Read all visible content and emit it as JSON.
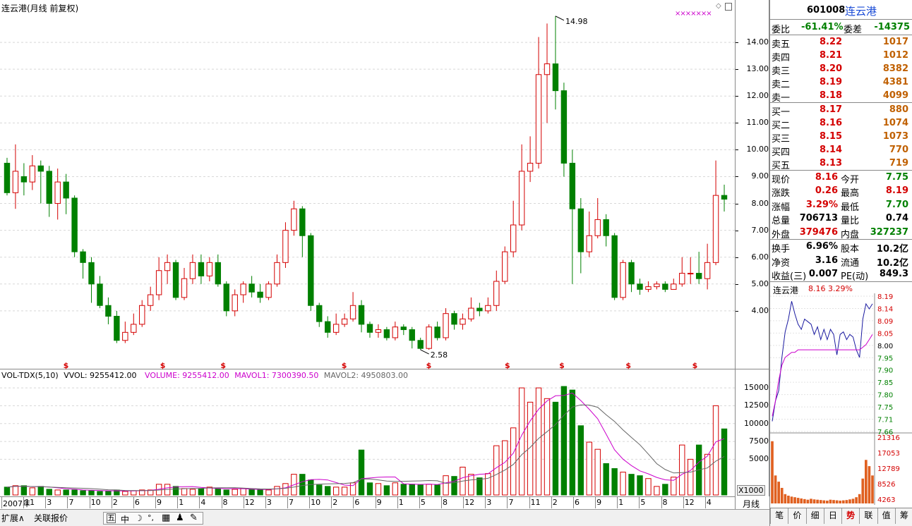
{
  "chart_header": "连云港(月线 前复权)",
  "price_labels": [
    "14.00",
    "13.00",
    "12.00",
    "11.00",
    "10.00",
    "9.00",
    "8.00",
    "7.00",
    "6.00",
    "5.00",
    "4.00"
  ],
  "price_values": [
    14,
    13,
    12,
    11,
    10,
    9,
    8,
    7,
    6,
    5,
    4
  ],
  "max_label": "14.98",
  "min_label": "2.58",
  "top_marker": "×××××××",
  "dollar_marks": [
    "$",
    "$",
    "$",
    "$",
    "$",
    "$",
    "$",
    "$",
    "$"
  ],
  "vol_header": {
    "title": "VOL-TDX(5,10)",
    "vvol": "VVOL: 9255412.00",
    "volume": "VOLUME: 9255412.00",
    "mavol1": "MAVOL1: 7300390.50",
    "mavol2": "MAVOL2: 4950803.00"
  },
  "vol_labels": [
    "15000",
    "12500",
    "10000",
    "7500",
    "5000"
  ],
  "vol_multiplier": "X1000",
  "time_labels": [
    "2007年",
    "11",
    "3",
    "7",
    "10",
    "2",
    "6",
    "9",
    "1",
    "4",
    "8",
    "12",
    "3",
    "7",
    "10",
    "2",
    "6",
    "9",
    "1",
    "5",
    "8",
    "12",
    "3",
    "7",
    "11",
    "2",
    "6",
    "9",
    "1",
    "5",
    "8",
    "12",
    "4"
  ],
  "period_label": "月线",
  "bottom_tabs": [
    "扩展∧",
    "关联报价"
  ],
  "toolbar_icons": [
    "五",
    "中",
    "☽",
    "°,",
    "▦",
    "♟",
    "✎"
  ],
  "quote": {
    "code": "601008",
    "name": "连云港",
    "weibi_label": "委比",
    "weibi": "-61.41%",
    "weicha_label": "委差",
    "weicha": "-14375",
    "sell": [
      {
        "label": "卖五",
        "price": "8.22",
        "vol": "1017"
      },
      {
        "label": "卖四",
        "price": "8.21",
        "vol": "1012"
      },
      {
        "label": "卖三",
        "price": "8.20",
        "vol": "8382"
      },
      {
        "label": "卖二",
        "price": "8.19",
        "vol": "4381"
      },
      {
        "label": "卖一",
        "price": "8.18",
        "vol": "4099"
      }
    ],
    "buy": [
      {
        "label": "买一",
        "price": "8.17",
        "vol": "880"
      },
      {
        "label": "买二",
        "price": "8.16",
        "vol": "1074"
      },
      {
        "label": "买三",
        "price": "8.15",
        "vol": "1073"
      },
      {
        "label": "买四",
        "price": "8.14",
        "vol": "770"
      },
      {
        "label": "买五",
        "price": "8.13",
        "vol": "719"
      }
    ],
    "stats": [
      {
        "l1": "现价",
        "v1": "8.16",
        "l2": "今开",
        "v2": "7.75",
        "c1": "red",
        "c2": "green"
      },
      {
        "l1": "涨跌",
        "v1": "0.26",
        "l2": "最高",
        "v2": "8.19",
        "c1": "red",
        "c2": "red"
      },
      {
        "l1": "涨幅",
        "v1": "3.29%",
        "l2": "最低",
        "v2": "7.70",
        "c1": "red",
        "c2": "green"
      },
      {
        "l1": "总量",
        "v1": "706713",
        "l2": "量比",
        "v2": "0.74",
        "c1": "black",
        "c2": "black"
      },
      {
        "l1": "外盘",
        "v1": "379476",
        "l2": "内盘",
        "v2": "327237",
        "c1": "red",
        "c2": "green"
      }
    ],
    "stats2": [
      {
        "l1": "换手",
        "v1": "6.96%",
        "l2": "股本",
        "v2": "10.2亿"
      },
      {
        "l1": "净资",
        "v1": "3.16",
        "l2": "流通",
        "v2": "10.2亿"
      },
      {
        "l1": "收益(三)",
        "v1": "0.007",
        "l2": "PE(动)",
        "v2": "849.3"
      }
    ]
  },
  "mini": {
    "name": "连云港",
    "price": "8.16",
    "pct": "3.29%",
    "price_labels": [
      "8.19",
      "8.14",
      "8.09",
      "8.05",
      "8.00",
      "7.95",
      "7.90",
      "7.85",
      "7.80",
      "7.75",
      "7.71",
      "7.66"
    ],
    "vol_labels": [
      "21316",
      "17053",
      "12789",
      "8526",
      "4263"
    ]
  },
  "right_tabs": [
    "笔",
    "价",
    "细",
    "日",
    "势",
    "联",
    "值",
    "筹"
  ],
  "colors": {
    "up": "#d40000",
    "down": "#008000",
    "ma1": "#cc00cc",
    "ma2": "#666666",
    "bg": "#ffffff"
  },
  "chart_data": {
    "type": "candlestick",
    "candles": [
      [
        9.5,
        8.4,
        9.7,
        8.3
      ],
      [
        8.4,
        9.2,
        10.2,
        7.8
      ],
      [
        9.0,
        8.8,
        9.5,
        8.3
      ],
      [
        8.8,
        9.4,
        9.8,
        8.5
      ],
      [
        9.4,
        9.2,
        9.6,
        8.0
      ],
      [
        9.2,
        8.0,
        9.4,
        7.5
      ],
      [
        8.0,
        8.8,
        9.3,
        7.4
      ],
      [
        8.8,
        8.2,
        9.1,
        7.6
      ],
      [
        8.2,
        6.2,
        8.3,
        6.0
      ],
      [
        6.2,
        5.8,
        6.3,
        5.2
      ],
      [
        5.8,
        5.0,
        6.0,
        4.3
      ],
      [
        5.0,
        4.2,
        5.3,
        4.1
      ],
      [
        4.2,
        3.8,
        4.5,
        3.5
      ],
      [
        3.8,
        2.9,
        4.0,
        2.8
      ],
      [
        2.9,
        3.2,
        3.6,
        2.8
      ],
      [
        3.2,
        3.5,
        3.9,
        3.1
      ],
      [
        3.5,
        4.2,
        4.4,
        3.4
      ],
      [
        4.2,
        4.6,
        4.9,
        4.0
      ],
      [
        4.6,
        5.5,
        6.0,
        4.4
      ],
      [
        5.5,
        5.8,
        6.1,
        5.0
      ],
      [
        5.8,
        4.5,
        5.9,
        4.4
      ],
      [
        4.5,
        5.2,
        5.6,
        4.4
      ],
      [
        5.2,
        5.8,
        6.1,
        5.0
      ],
      [
        5.8,
        5.3,
        6.1,
        5.0
      ],
      [
        5.3,
        5.8,
        6.0,
        5.1
      ],
      [
        5.8,
        5.0,
        6.1,
        4.9
      ],
      [
        5.0,
        4.0,
        5.1,
        3.8
      ],
      [
        4.0,
        4.6,
        4.8,
        3.8
      ],
      [
        4.6,
        5.0,
        5.1,
        4.3
      ],
      [
        5.0,
        4.7,
        5.3,
        4.5
      ],
      [
        4.7,
        4.5,
        5.0,
        4.3
      ],
      [
        4.5,
        5.0,
        5.1,
        4.4
      ],
      [
        5.0,
        5.8,
        6.1,
        4.9
      ],
      [
        5.8,
        7.0,
        7.3,
        5.6
      ],
      [
        7.0,
        7.8,
        8.1,
        6.8
      ],
      [
        7.8,
        6.8,
        7.9,
        6.0
      ],
      [
        6.8,
        4.2,
        6.9,
        4.0
      ],
      [
        4.2,
        3.6,
        4.3,
        3.4
      ],
      [
        3.6,
        3.2,
        3.8,
        3.0
      ],
      [
        3.2,
        3.5,
        3.9,
        3.1
      ],
      [
        3.5,
        3.7,
        3.9,
        3.4
      ],
      [
        3.7,
        4.2,
        4.7,
        3.6
      ],
      [
        4.2,
        3.5,
        4.4,
        3.2
      ],
      [
        3.5,
        3.2,
        3.6,
        3.0
      ],
      [
        3.2,
        3.3,
        3.5,
        3.0
      ],
      [
        3.3,
        3.0,
        3.4,
        2.9
      ],
      [
        3.0,
        3.4,
        3.6,
        2.9
      ],
      [
        3.4,
        3.3,
        3.5,
        3.1
      ],
      [
        3.3,
        2.9,
        3.4,
        2.6
      ],
      [
        2.9,
        2.6,
        3.0,
        2.55
      ],
      [
        2.6,
        3.4,
        3.5,
        2.55
      ],
      [
        3.4,
        3.0,
        3.6,
        2.9
      ],
      [
        3.0,
        3.9,
        4.1,
        2.9
      ],
      [
        3.9,
        3.5,
        4.0,
        3.3
      ],
      [
        3.5,
        3.7,
        3.9,
        3.3
      ],
      [
        3.7,
        4.1,
        4.5,
        3.6
      ],
      [
        4.1,
        4.0,
        4.3,
        3.8
      ],
      [
        4.0,
        4.2,
        4.5,
        3.9
      ],
      [
        4.2,
        5.1,
        5.5,
        4.0
      ],
      [
        5.1,
        6.2,
        6.4,
        5.0
      ],
      [
        6.2,
        7.2,
        8.1,
        6.0
      ],
      [
        7.2,
        9.2,
        10.2,
        7.0
      ],
      [
        9.2,
        9.5,
        10.5,
        8.8
      ],
      [
        9.5,
        12.8,
        14.2,
        9.3
      ],
      [
        12.8,
        13.2,
        14.7,
        11.0
      ],
      [
        13.2,
        12.2,
        14.98,
        11.5
      ],
      [
        12.2,
        9.5,
        12.5,
        9.0
      ],
      [
        9.5,
        7.8,
        10.0,
        5.0
      ],
      [
        7.8,
        6.2,
        8.2,
        5.4
      ],
      [
        6.2,
        6.8,
        7.7,
        6.0
      ],
      [
        6.8,
        7.4,
        8.2,
        6.7
      ],
      [
        7.4,
        6.8,
        7.6,
        6.4
      ],
      [
        6.8,
        4.5,
        6.9,
        4.4
      ],
      [
        4.5,
        5.8,
        5.9,
        4.4
      ],
      [
        5.8,
        5.0,
        5.9,
        4.7
      ],
      [
        5.0,
        4.8,
        5.2,
        4.6
      ],
      [
        4.8,
        4.9,
        5.1,
        4.7
      ],
      [
        4.9,
        5.0,
        5.1,
        4.8
      ],
      [
        5.0,
        4.8,
        5.1,
        4.7
      ],
      [
        4.8,
        5.0,
        5.2,
        4.8
      ],
      [
        5.0,
        5.4,
        6.0,
        4.9
      ],
      [
        5.4,
        5.4,
        6.0,
        5.0
      ],
      [
        5.4,
        5.2,
        6.2,
        5.0
      ],
      [
        5.2,
        5.8,
        6.5,
        4.8
      ],
      [
        5.8,
        8.3,
        9.6,
        5.7
      ],
      [
        8.3,
        8.16,
        8.7,
        7.7
      ]
    ],
    "volume": [
      1100,
      1300,
      1300,
      1000,
      1200,
      800,
      700,
      700,
      700,
      600,
      600,
      500,
      500,
      700,
      500,
      600,
      700,
      700,
      1500,
      1500,
      1200,
      900,
      800,
      900,
      1100,
      900,
      700,
      800,
      900,
      800,
      700,
      700,
      1200,
      1600,
      2900,
      2900,
      2100,
      1400,
      1200,
      1100,
      1100,
      1700,
      6300,
      1700,
      1600,
      1300,
      1700,
      1500,
      1500,
      1400,
      1500,
      1400,
      2700,
      2600,
      3900,
      2900,
      2400,
      3000,
      6900,
      7600,
      9400,
      15000,
      13000,
      15000,
      13500,
      13000,
      15200,
      14700,
      9700,
      7400,
      6400,
      4400,
      3700,
      3200,
      2900,
      2700,
      2300,
      1200,
      1500,
      2500,
      7000,
      5000,
      7000,
      5700,
      12500,
      9255
    ],
    "ylim": [
      2.5,
      15.0
    ],
    "vol_ylim": [
      0,
      16000
    ]
  }
}
